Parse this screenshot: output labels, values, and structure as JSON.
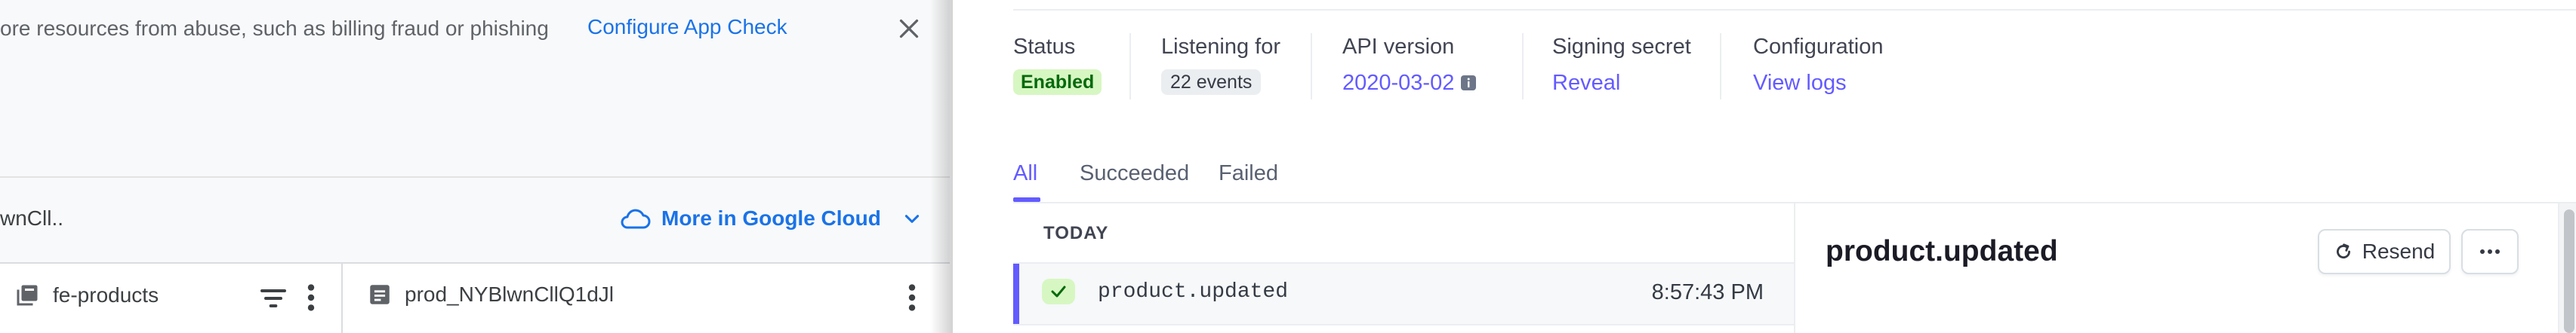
{
  "left_pane": {
    "banner": {
      "text": "ore resources from abuse, such as billing fraud or phishing",
      "link": "Configure App Check"
    },
    "path_row": {
      "text": "wnCll..",
      "google_cloud_link": "More in Google Cloud"
    },
    "columns": {
      "collection_name": "fe-products",
      "document_id": "prod_NYBlwnCllQ1dJl"
    }
  },
  "right_pane": {
    "meta": {
      "status_label": "Status",
      "status_value": "Enabled",
      "listening_label": "Listening for",
      "listening_value": "22 events",
      "api_label": "API version",
      "api_value": "2020-03-02",
      "secret_label": "Signing secret",
      "secret_value": "Reveal",
      "config_label": "Configuration",
      "config_value": "View logs"
    },
    "tabs": [
      {
        "label": "All",
        "active": true
      },
      {
        "label": "Succeeded",
        "active": false
      },
      {
        "label": "Failed",
        "active": false
      }
    ],
    "events": {
      "group_label": "TODAY",
      "rows": [
        {
          "event": "product.updated",
          "time": "8:57:43 PM",
          "status": "succeeded"
        }
      ]
    },
    "detail": {
      "title": "product.updated",
      "resend_label": "Resend"
    }
  },
  "colors": {
    "stripe_accent": "#635bff",
    "google_blue": "#1a73e8",
    "success_bg": "#d7f7c2",
    "success_fg": "#05690d"
  }
}
